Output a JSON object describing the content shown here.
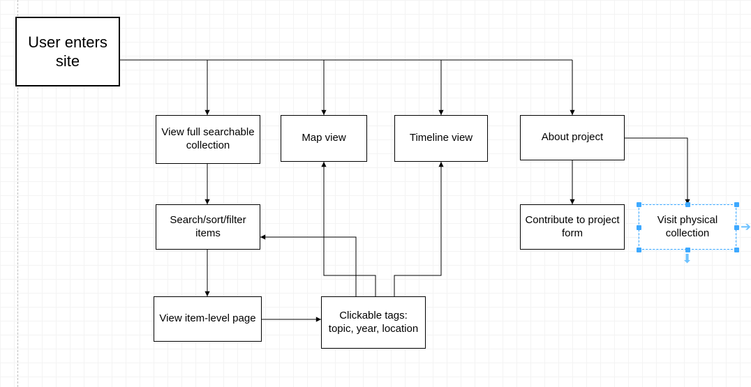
{
  "nodes": {
    "entry": {
      "label": "User enters site"
    },
    "view_full": {
      "label": "View full searchable collection"
    },
    "map": {
      "label": "Map view"
    },
    "timeline": {
      "label": "Timeline view"
    },
    "about": {
      "label": "About project"
    },
    "search": {
      "label": "Search/sort/filter items"
    },
    "contribute": {
      "label": "Contribute to project form"
    },
    "visit": {
      "label": "Visit physical collection"
    },
    "item_page": {
      "label": "View item-level page"
    },
    "tags": {
      "label": "Clickable tags: topic, year, location"
    }
  },
  "edges": [
    {
      "from": "entry",
      "to": "view_full"
    },
    {
      "from": "entry",
      "to": "map"
    },
    {
      "from": "entry",
      "to": "timeline"
    },
    {
      "from": "entry",
      "to": "about"
    },
    {
      "from": "view_full",
      "to": "search"
    },
    {
      "from": "search",
      "to": "item_page"
    },
    {
      "from": "item_page",
      "to": "tags"
    },
    {
      "from": "tags",
      "to": "search"
    },
    {
      "from": "tags",
      "to": "map"
    },
    {
      "from": "tags",
      "to": "timeline"
    },
    {
      "from": "about",
      "to": "contribute"
    },
    {
      "from": "about",
      "to": "visit"
    }
  ],
  "selection": "visit"
}
